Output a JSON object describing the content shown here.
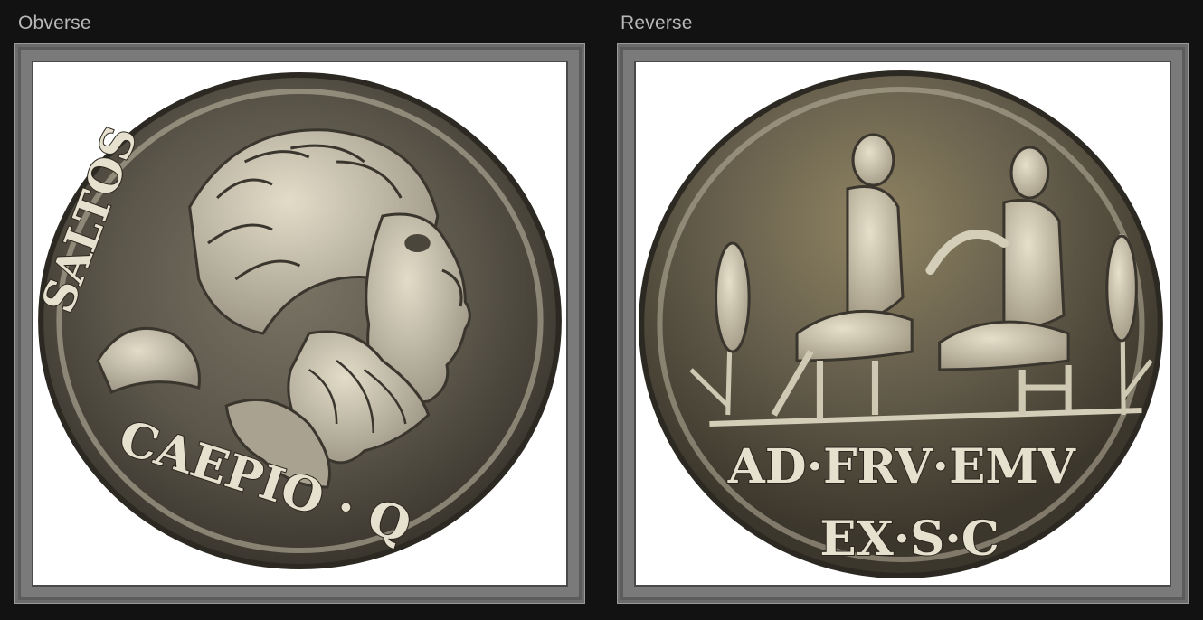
{
  "panels": {
    "obverse": {
      "label": "Obverse",
      "inscription_top": "SALTOS",
      "inscription_bottom": "CAEPIO · Q",
      "subject": "laureate-bearded-head-right",
      "colors": {
        "coin_base": "#5b564a",
        "relief": "#cfc9b6",
        "background": "#ffffff"
      }
    },
    "reverse": {
      "label": "Reverse",
      "inscription_line1": "AD·FRV·EMV",
      "inscription_line2": "EX·S·C",
      "subject": "two-seated-figures-between-grain-ears",
      "colors": {
        "coin_base": "#625b4a",
        "relief": "#d4cdb8",
        "background": "#ffffff"
      }
    }
  }
}
